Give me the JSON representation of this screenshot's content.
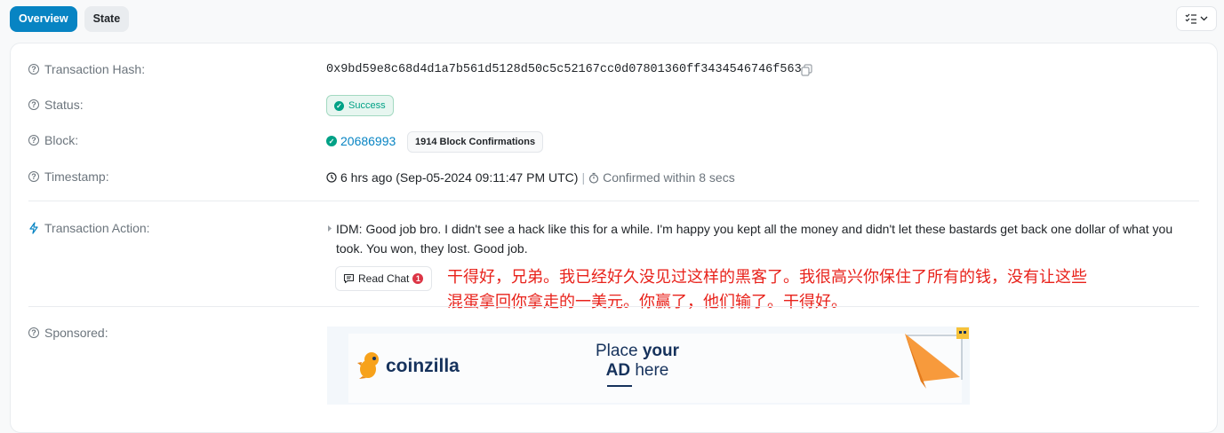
{
  "tabs": [
    {
      "label": "Overview",
      "active": true
    },
    {
      "label": "State",
      "active": false
    }
  ],
  "view_button": {
    "icon": "list-filter-icon",
    "chevron": "chevron-down-icon"
  },
  "rows": {
    "tx_hash": {
      "label": "Transaction Hash:",
      "value": "0x9bd59e8c68d4d1a7b561d5128d50c5c52167cc0d07801360ff3434546746f563"
    },
    "status": {
      "label": "Status:",
      "value": "Success"
    },
    "block": {
      "label": "Block:",
      "number": "20686993",
      "confirmations": "1914 Block Confirmations"
    },
    "timestamp": {
      "label": "Timestamp:",
      "value": "6 hrs ago (Sep-05-2024 09:11:47 PM UTC)",
      "separator": "|",
      "confirmed": "Confirmed within 8 secs"
    },
    "action": {
      "label": "Transaction Action:",
      "text": "IDM: Good job bro. I didn't see a hack like this for a while. I'm happy you kept all the money and didn't let these bastards get back one dollar of what you took. You won, they lost. Good job.",
      "read_chat": "Read Chat",
      "chat_count": "1"
    },
    "sponsored": {
      "label": "Sponsored:"
    }
  },
  "overlay_translation": "干得好，兄弟。我已经好久没见过这样的黑客了。我很高兴你保住了所有的钱，没有让这些混蛋拿回你拿走的一美元。你赢了，他们输了。干得好。",
  "ad": {
    "brand": "coinzilla",
    "line1_a": "Place",
    "line1_b": "your",
    "line2_a": "AD",
    "line2_b": "here"
  },
  "colors": {
    "accent": "#0784c3",
    "success": "#00a186",
    "annotation": "#e8221b"
  }
}
